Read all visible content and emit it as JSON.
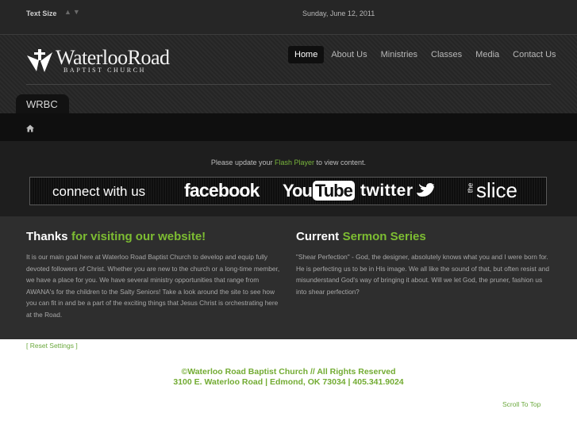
{
  "topbar": {
    "text_size_label": "Text Size",
    "arrows": "▲▼",
    "date": "Sunday, June 12, 2011"
  },
  "logo": {
    "name": "WaterlooRoad",
    "sub": "BAPTIST CHURCH"
  },
  "nav": {
    "items": [
      {
        "label": "Home"
      },
      {
        "label": "About Us"
      },
      {
        "label": "Ministries"
      },
      {
        "label": "Classes"
      },
      {
        "label": "Media"
      },
      {
        "label": "Contact Us"
      }
    ]
  },
  "tab": {
    "label": "WRBC"
  },
  "flash": {
    "prefix": "Please update your ",
    "link": "Flash Player",
    "suffix": " to view content."
  },
  "banner": {
    "connect": "connect with us",
    "facebook": "facebook",
    "youtube_you": "You",
    "youtube_tube": "Tube",
    "twitter": "twitter",
    "the": "the",
    "slice": "slice"
  },
  "welcome": {
    "title_white": "Thanks",
    "title_green": "for visiting our website!",
    "text": "It is our main goal here at Waterloo Road Baptist Church to develop and equip fully devoted followers of Christ.  Whether you are new to the church or a long-time member, we have a place for you.  We have several ministry opportunities that range from AWANA's for the children to the Salty Seniors!  Take a look around the site to see how you can fit in and be a part of the exciting things that Jesus Christ is orchestrating here at the Road."
  },
  "sermon": {
    "title_white": "Current",
    "title_green": "Sermon Series",
    "text": "\"Shear Perfection\" - God, the designer, absolutely knows what you and I were born for.  He is perfecting us to be in His image.  We all like the sound of that, but often resist and misunderstand God's way of bringing it about.  Will we let God, the pruner, fashion us into shear perfection?"
  },
  "reset_settings": "[ Reset Settings ]",
  "footer": {
    "line1": "©Waterloo Road Baptist Church // All Rights Reserved",
    "line2": "3100 E. Waterloo Road | Edmond, OK 73034 | 405.341.9024",
    "scroll_top": "Scroll To Top"
  },
  "colors": {
    "accent_green": "#7dbd32",
    "nav_active_bg": "#0f0f0f",
    "header_bg": "#262626"
  },
  "icons": [
    "arrow-up-icon",
    "arrow-down-icon",
    "home-icon",
    "twitter-bird-icon",
    "logo-mark-icon"
  ]
}
